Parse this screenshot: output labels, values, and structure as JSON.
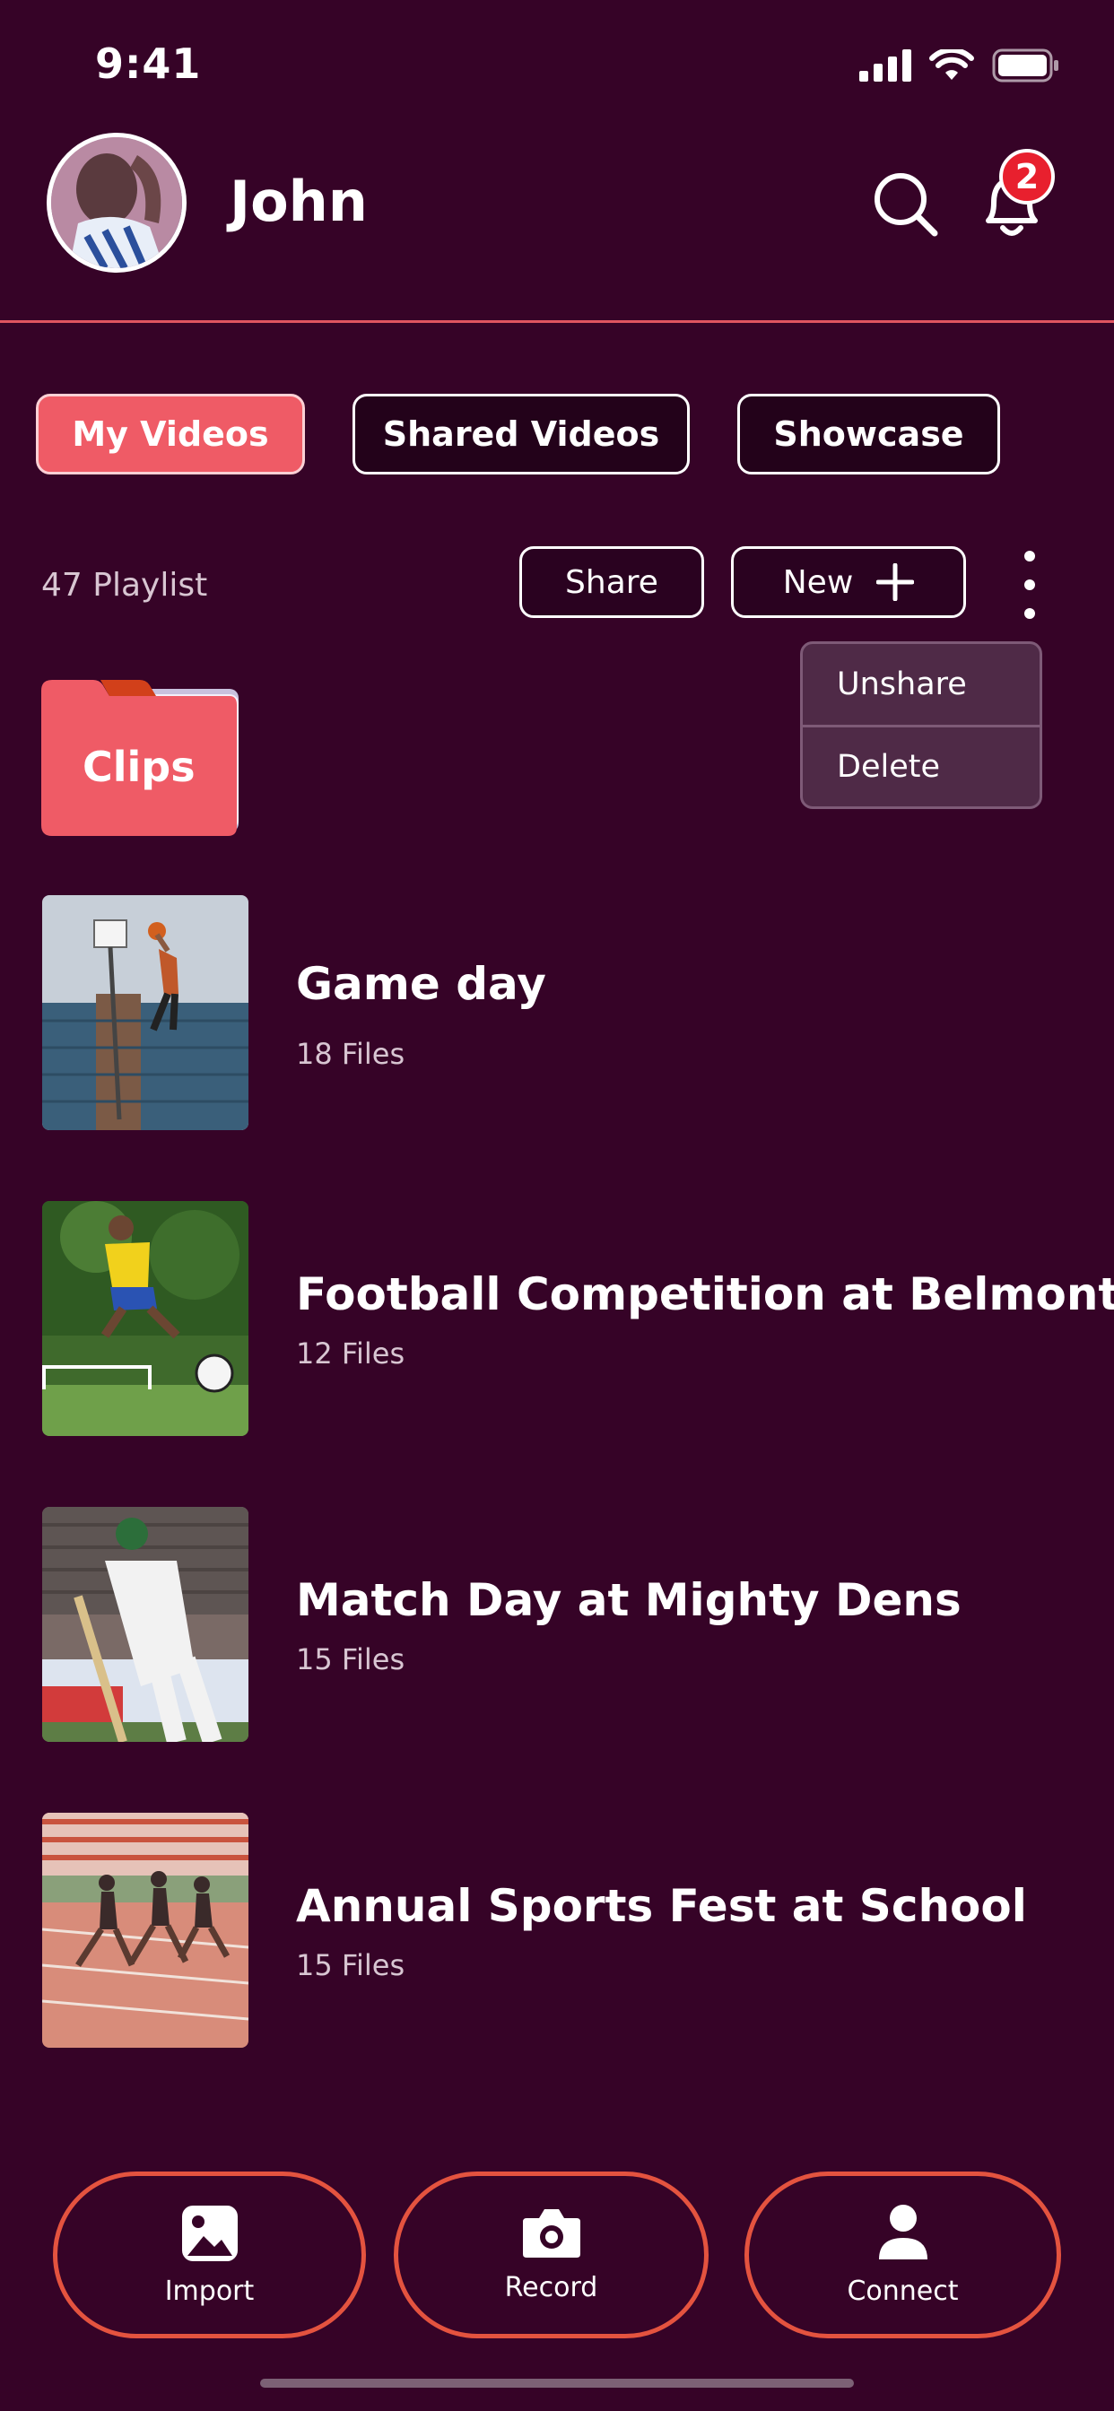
{
  "status_bar": {
    "time": "9:41"
  },
  "header": {
    "user_name": "John",
    "notification_count": "2"
  },
  "tabs": [
    {
      "label": "My Videos",
      "active": true
    },
    {
      "label": "Shared Videos",
      "active": false
    },
    {
      "label": "Showcase",
      "active": false
    }
  ],
  "toolbar": {
    "playlist_count": "47 Playlist",
    "share_label": "Share",
    "new_label": "New"
  },
  "menu": {
    "items": [
      "Unshare",
      "Delete"
    ]
  },
  "folder": {
    "label": "Clips"
  },
  "playlists": [
    {
      "title": "Game day",
      "files": "18 Files"
    },
    {
      "title": "Football Competition at Belmont",
      "files": "12 Files"
    },
    {
      "title": "Match Day at Mighty Dens",
      "files": "15 Files"
    },
    {
      "title": "Annual Sports Fest at School",
      "files": "15 Files"
    }
  ],
  "bottom_nav": {
    "import_label": "Import",
    "record_label": "Record",
    "connect_label": "Connect"
  },
  "colors": {
    "background": "#360327",
    "accent": "#ef5b66",
    "divider": "#e05560",
    "bottom_border": "#e4533f",
    "badge": "#e8202e"
  }
}
